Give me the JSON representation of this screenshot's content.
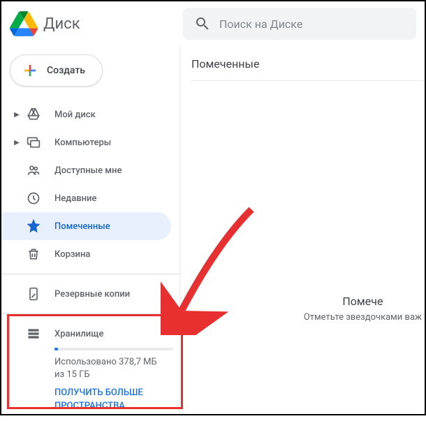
{
  "header": {
    "logo_text": "Диск",
    "search_placeholder": "Поиск на Диске"
  },
  "sidebar": {
    "create_label": "Создать",
    "items": [
      {
        "label": "Мой диск",
        "icon": "drive",
        "expandable": true
      },
      {
        "label": "Компьютеры",
        "icon": "computers",
        "expandable": true
      },
      {
        "label": "Доступные мне",
        "icon": "shared",
        "expandable": false
      },
      {
        "label": "Недавние",
        "icon": "clock",
        "expandable": false
      },
      {
        "label": "Помеченные",
        "icon": "star",
        "expandable": false,
        "active": true
      },
      {
        "label": "Корзина",
        "icon": "trash",
        "expandable": false
      }
    ],
    "backups_label": "Резервные копии",
    "storage": {
      "title": "Хранилище",
      "used_text": "Использовано 378,7 МБ из 15 ГБ",
      "more_link": "ПОЛУЧИТЬ БОЛЬШЕ ПРОСТРАНСТВА",
      "percent": 2.5
    }
  },
  "main": {
    "title": "Помеченные"
  },
  "empty": {
    "title": "Помече",
    "subtitle": "Отметьте звездочками важ"
  },
  "colors": {
    "accent": "#1a73e8",
    "highlight": "#e83030"
  }
}
